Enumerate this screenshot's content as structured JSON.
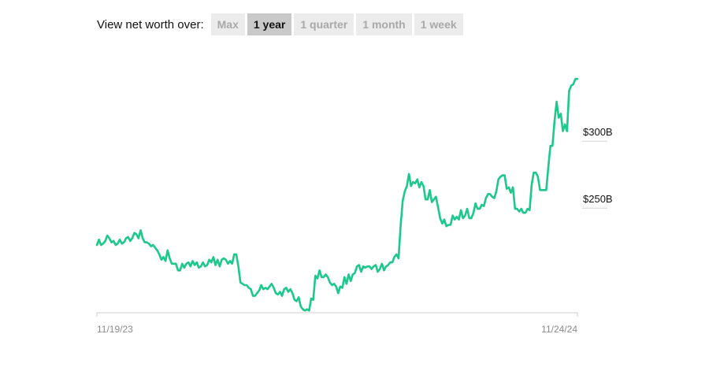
{
  "toolbar": {
    "label": "View net worth over:",
    "tabs": [
      {
        "label": "Max",
        "active": false
      },
      {
        "label": "1 year",
        "active": true
      },
      {
        "label": "1 quarter",
        "active": false
      },
      {
        "label": "1 month",
        "active": false
      },
      {
        "label": "1 week",
        "active": false
      }
    ]
  },
  "chart_data": {
    "type": "line",
    "title": "",
    "xlabel": "",
    "ylabel": "",
    "x_start": "11/19/23",
    "x_end": "11/24/24",
    "xticks": [
      "11/19/23",
      "11/24/24"
    ],
    "yticks": [
      {
        "value": 300,
        "label": "$300B"
      },
      {
        "value": 250,
        "label": "$250B"
      }
    ],
    "ylim": [
      166,
      346
    ],
    "grid": false,
    "line_color": "#1cc88a",
    "series": [
      {
        "values": [
          216,
          220,
          216,
          217,
          219,
          223,
          221,
          218,
          219,
          216,
          217,
          220,
          217,
          218,
          221,
          222,
          219,
          221,
          225,
          224,
          221,
          227,
          221,
          218,
          218,
          217,
          215,
          216,
          214,
          212,
          209,
          205,
          207,
          204,
          212,
          206,
          202,
          202,
          202,
          197,
          197,
          202,
          199,
          202,
          203,
          200,
          204,
          201,
          203,
          199,
          200,
          203,
          200,
          201,
          205,
          203,
          207,
          201,
          205,
          200,
          205,
          206,
          205,
          202,
          204,
          202,
          209,
          209,
          200,
          188,
          187,
          186,
          186,
          184,
          183,
          178,
          178,
          180,
          182,
          186,
          183,
          184,
          183,
          185,
          187,
          184,
          180,
          179,
          181,
          178,
          183,
          184,
          181,
          183,
          180,
          175,
          174,
          177,
          170,
          168,
          167,
          168,
          167,
          176,
          175,
          193,
          191,
          197,
          192,
          192,
          194,
          192,
          188,
          186,
          187,
          185,
          180,
          185,
          184,
          192,
          187,
          194,
          189,
          194,
          195,
          200,
          201,
          196,
          200,
          199,
          200,
          200,
          198,
          200,
          201,
          196,
          198,
          202,
          197,
          200,
          201,
          203,
          203,
          207,
          209,
          206,
          230,
          249,
          256,
          260,
          269,
          260,
          263,
          262,
          265,
          259,
          263,
          260,
          250,
          250,
          257,
          248,
          250,
          252,
          244,
          236,
          232,
          235,
          230,
          231,
          231,
          238,
          235,
          237,
          235,
          242,
          236,
          238,
          243,
          236,
          236,
          240,
          247,
          243,
          243,
          246,
          245,
          251,
          254,
          254,
          252,
          251,
          256,
          265,
          267,
          268,
          268,
          258,
          259,
          255,
          259,
          243,
          243,
          241,
          243,
          240,
          240,
          243,
          242,
          261,
          270,
          270,
          267,
          257,
          257,
          257,
          257,
          274,
          290,
          290,
          309,
          323,
          311,
          314,
          301,
          306,
          301,
          331,
          335,
          336,
          340,
          340
        ]
      }
    ]
  }
}
